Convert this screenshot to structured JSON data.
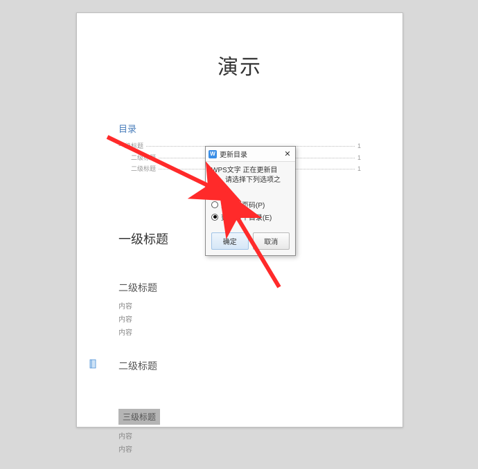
{
  "doc": {
    "title": "演示",
    "toc_heading": "目录",
    "toc": [
      {
        "label": "一级标题",
        "page": "1",
        "level": 1
      },
      {
        "label": "二级标题",
        "page": "1",
        "level": 2
      },
      {
        "label": "二级标题",
        "page": "1",
        "level": 2
      }
    ],
    "h1": "一级标题",
    "h2_1": "二级标题",
    "body1": "内容",
    "body2": "内容",
    "body3": "内容",
    "h2_2": "二级标题",
    "h3": "三级标题",
    "body4": "内容",
    "body5": "内容"
  },
  "dialog": {
    "title": "更新目录",
    "message": "WPS文字 正在更新目录，请选择下列选项之一：",
    "option1": "只更新页码(P)",
    "option2": "更新整个目录(E)",
    "ok": "确定",
    "cancel": "取消",
    "icon_letter": "W"
  }
}
